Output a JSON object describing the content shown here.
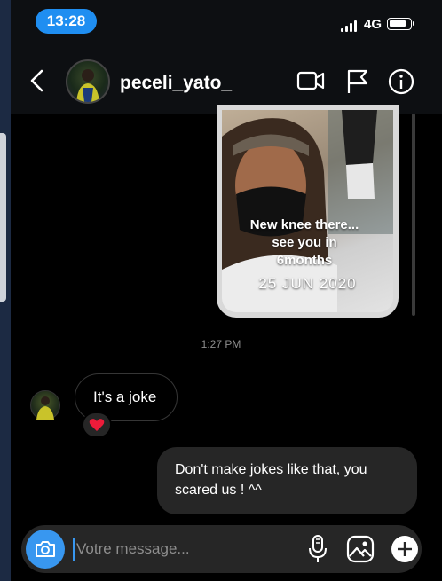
{
  "status_bar": {
    "time": "13:28",
    "network": "4G"
  },
  "header": {
    "username": "peceli_yato_"
  },
  "story": {
    "caption_lines": [
      "New knee there...",
      "see you in",
      "6months"
    ],
    "date": "25 JUN 2020"
  },
  "timestamp": "1:27 PM",
  "messages": {
    "incoming": {
      "text": "It's a joke",
      "reaction": "❤️"
    },
    "outgoing": {
      "text": "Don't make jokes like that, you scared us ! ^^"
    }
  },
  "composer": {
    "placeholder": "Votre message..."
  },
  "colors": {
    "accent": "#3897f0",
    "time_pill": "#1f8ef1",
    "bubble": "#262626"
  },
  "icons": [
    "back-chevron-icon",
    "video-camera-icon",
    "flag-icon",
    "info-icon",
    "camera-icon",
    "microphone-icon",
    "gallery-icon",
    "plus-icon",
    "heart-icon"
  ]
}
